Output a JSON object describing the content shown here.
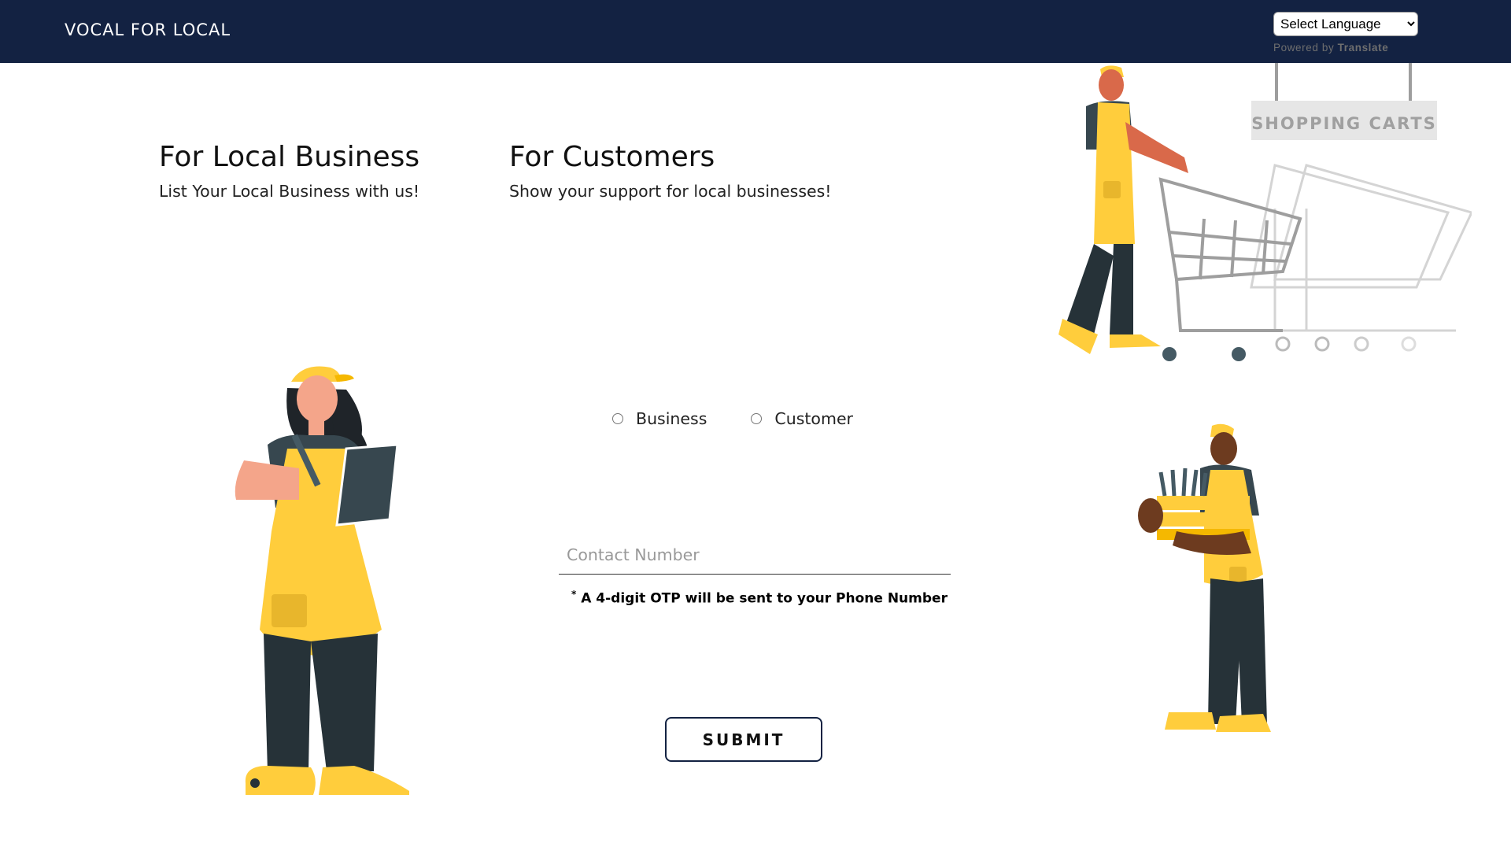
{
  "navbar": {
    "brand": "VOCAL FOR LOCAL",
    "language_select": {
      "selected": "Select Language",
      "options": [
        "Select Language"
      ]
    },
    "powered_by_label": "Powered by",
    "powered_by_service": "Translate"
  },
  "sections": {
    "business": {
      "title": "For Local Business",
      "subtitle": "List Your Local Business with us!"
    },
    "customers": {
      "title": "For Customers",
      "subtitle": "Show your support for local businesses!"
    }
  },
  "form": {
    "role_options": [
      {
        "label": "Business",
        "checked": false
      },
      {
        "label": "Customer",
        "checked": false
      }
    ],
    "contact_placeholder": "Contact Number",
    "contact_value": "",
    "otp_asterisk": "*",
    "otp_note": "A 4-digit OTP will be sent to your Phone Number",
    "submit_label": "SUBMIT"
  },
  "illustrations": {
    "store_sign": "SHOPPING CARTS"
  },
  "colors": {
    "navbar_bg": "#132242",
    "accent_yellow": "#FFCD3C",
    "dark_clothing": "#263238",
    "cart_gray": "#BDBDBD"
  }
}
